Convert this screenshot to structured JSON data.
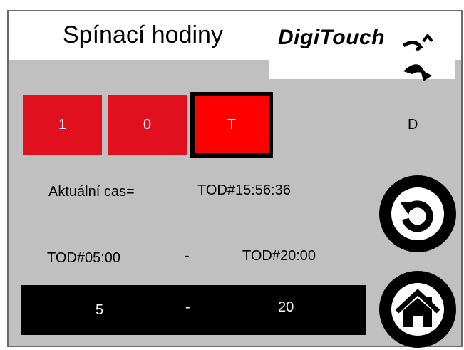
{
  "header": {
    "title": "Spínací hodiny",
    "logo_text": "DigiTouch"
  },
  "buttons": [
    {
      "label": "1"
    },
    {
      "label": "0"
    },
    {
      "label": "T"
    }
  ],
  "mode_indicator": "D",
  "current_time": {
    "label": "Aktuální cas=",
    "value": "TOD#15:56:36"
  },
  "schedule": {
    "start": "TOD#05:00",
    "separator": "-",
    "end": "TOD#20:00"
  },
  "range_inputs": {
    "start_value": "5",
    "separator": "-",
    "end_value": "20"
  },
  "nav": {
    "back_icon": "back-arrow-icon",
    "home_icon": "home-icon"
  },
  "colors": {
    "panel_bg": "#c0c0c0",
    "button_red": "#e0101e",
    "button_active_red": "#ff0000",
    "range_bar": "#000000"
  }
}
